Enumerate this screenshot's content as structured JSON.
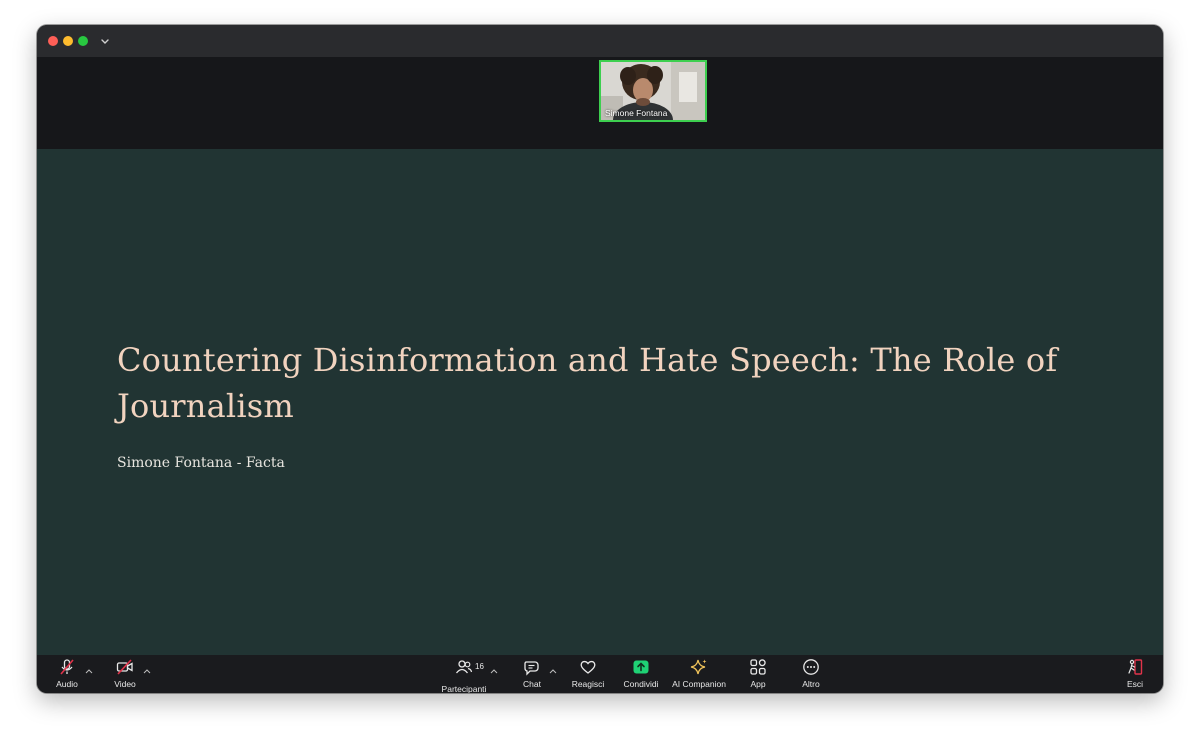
{
  "window": {
    "traffic_lights": [
      "close-button",
      "minimize-button",
      "zoom-button"
    ],
    "title_menu_icon": "chevron-down-icon"
  },
  "participant_thumbnail": {
    "name": "Simone Fontana",
    "border_color": "#3dcf4f"
  },
  "slide": {
    "title": "Countering Disinformation and Hate Speech: The Role of Journalism",
    "subtitle": "Simone Fontana - Facta",
    "background": "#213433",
    "title_color": "#f1d3bf"
  },
  "toolbar": {
    "audio_label": "Audio",
    "video_label": "Video",
    "participants_label": "Partecipanti",
    "participants_count": "16",
    "chat_label": "Chat",
    "react_label": "Reagisci",
    "share_label": "Condividi",
    "ai_label": "AI Companion",
    "apps_label": "App",
    "more_label": "Altro",
    "leave_label": "Esci",
    "icons": {
      "audio": "microphone-muted-icon",
      "video": "camera-off-icon",
      "participants": "people-icon",
      "chat": "chat-bubble-icon",
      "react": "heart-icon",
      "share": "share-screen-icon",
      "ai": "sparkle-icon",
      "apps": "apps-icon",
      "more": "ellipsis-icon",
      "leave": "exit-icon"
    },
    "muted_color": "#e0334a",
    "share_color": "#1fd275"
  }
}
